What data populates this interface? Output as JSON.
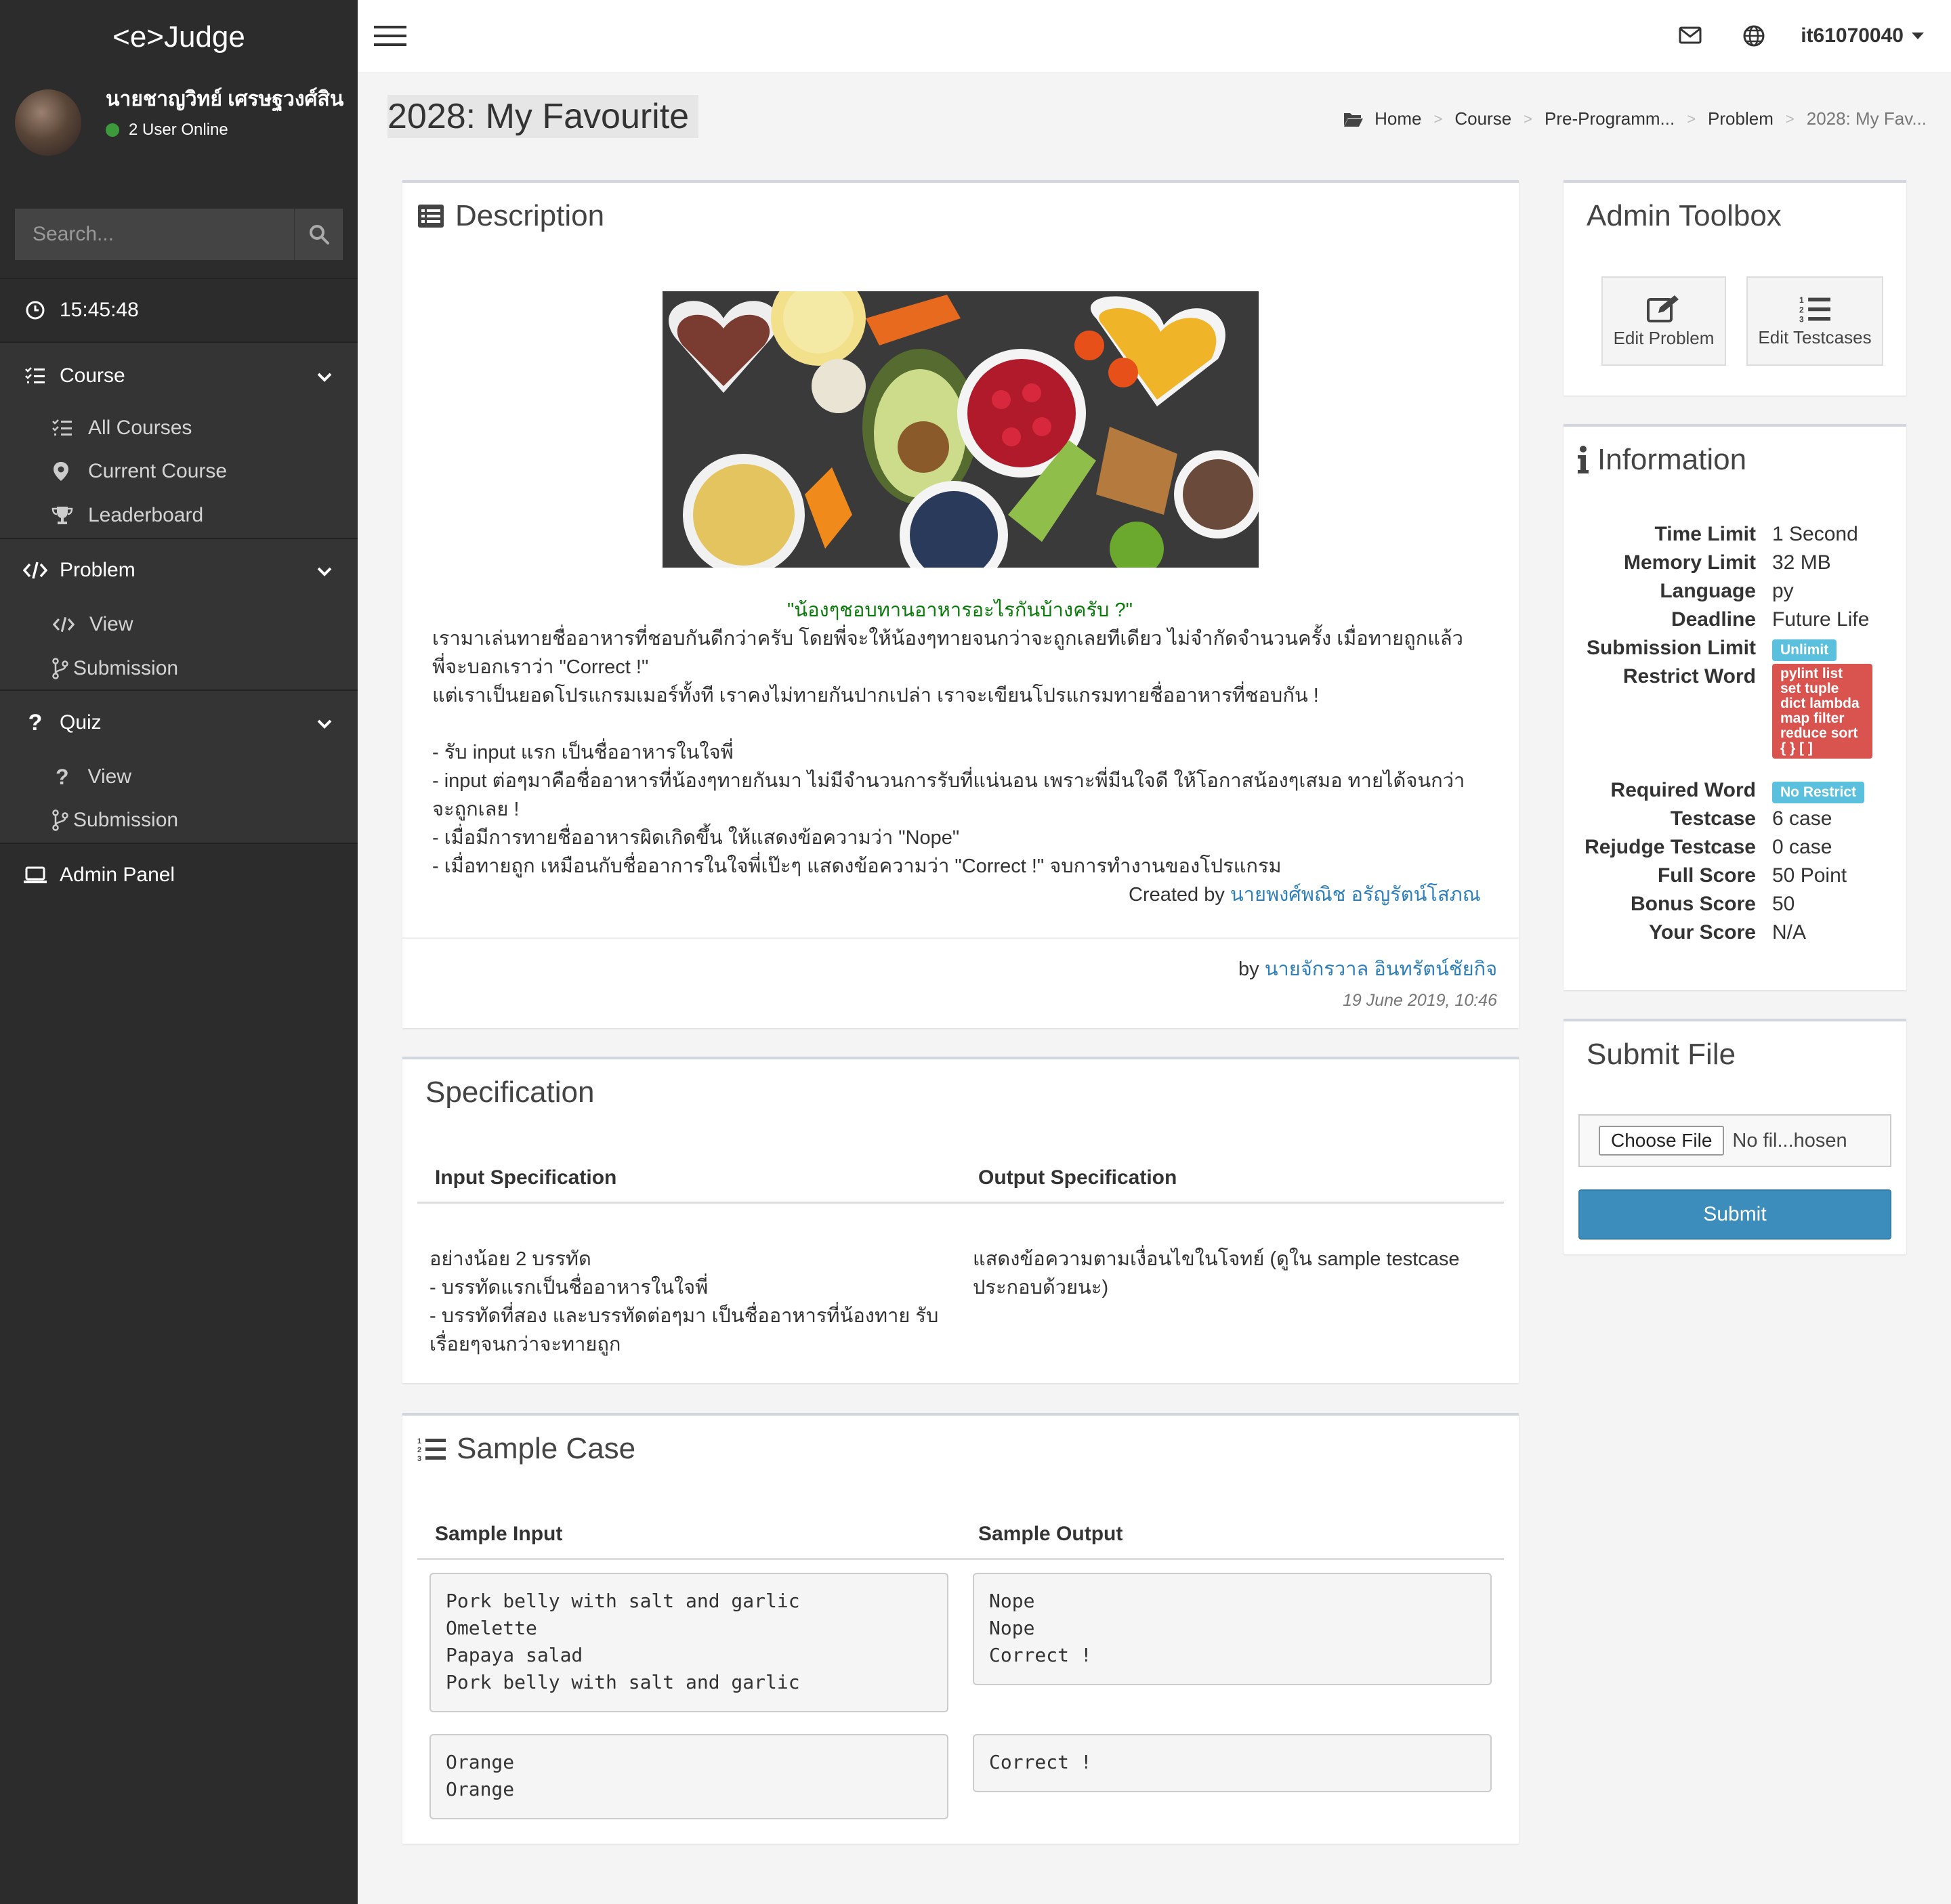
{
  "app": {
    "logo": "<e>Judge"
  },
  "user": {
    "name": "นายชาญวิทย์ เศรษฐวงศ์สิน",
    "online_text": "2 User Online",
    "username": "it61070040"
  },
  "search": {
    "placeholder": "Search..."
  },
  "clock": {
    "time": "15:45:48"
  },
  "sidebar": {
    "course": {
      "label": "Course",
      "items": [
        "All Courses",
        "Current Course",
        "Leaderboard"
      ]
    },
    "problem": {
      "label": "Problem",
      "items": [
        "View",
        "Submission"
      ]
    },
    "quiz": {
      "label": "Quiz",
      "items": [
        "View",
        "Submission"
      ]
    },
    "admin": {
      "label": "Admin Panel"
    }
  },
  "page": {
    "title": "2028: My Favourite"
  },
  "breadcrumb": [
    "Home",
    "Course",
    "Pre-Programm...",
    "Problem",
    "2028: My Fav..."
  ],
  "description": {
    "title": "Description",
    "headline": "\"น้องๆชอบทานอาหารอะไรกันบ้างครับ ?\"",
    "lines": [
      "    เรามาเล่นทายชื่ออาหารที่ชอบกันดีกว่าครับ โดยพี่จะให้น้องๆทายจนกว่าจะถูกเลยทีเดียว ไม่จำกัดจำนวนครั้ง เมื่อทายถูกแล้ว",
      "พี่จะบอกเราว่า \"Correct !\"",
      "แต่เราเป็นยอดโปรแกรมเมอร์ทั้งที เราคงไม่ทายกันปากเปล่า เราจะเขียนโปรแกรมทายชื่ออาหารที่ชอบกัน !",
      "",
      "- รับ input แรก เป็นชื่ออาหารในใจพี่",
      "- input ต่อๆมาคือชื่ออาหารที่น้องๆทายกันมา ไม่มีจำนวนการรับที่แน่นอน เพราะพี่มีนใจดี ให้โอกาสน้องๆเสมอ ทายได้จนกว่า",
      "จะถูกเลย !",
      "- เมื่อมีการทายชื่ออาหารผิดเกิดขึ้น ให้แสดงข้อความว่า \"Nope\"",
      "- เมื่อทายถูก เหมือนกับชื่ออาการในใจพี่เป๊ะๆ แสดงข้อความว่า \"Correct !\" จบการทำงานของโปรแกรม"
    ],
    "created_by_label": "Created by",
    "created_by_name": "นายพงศ์พณิช อรัญรัตน์โสภณ",
    "by_label": "by",
    "author": "นายจักรวาล อินทรัตน์ชัยกิจ",
    "date": "19 June 2019, 10:46"
  },
  "specification": {
    "title": "Specification",
    "input_header": "Input Specification",
    "output_header": "Output Specification",
    "input_lines": [
      "อย่างน้อย 2 บรรทัด",
      "- บรรทัดแรกเป็นชื่ออาหารในใจพี่",
      "- บรรทัดที่สอง และบรรทัดต่อๆมา เป็นชื่ออาหารที่น้องทาย รับ",
      "เรื่อยๆจนกว่าจะทายถูก"
    ],
    "output_lines": [
      "แสดงข้อความตามเงื่อนไขในโจทย์ (ดูใน sample testcase",
      "ประกอบด้วยนะ)"
    ]
  },
  "sample": {
    "title": "Sample Case",
    "input_header": "Sample Input",
    "output_header": "Sample Output",
    "cases": [
      {
        "input": "Pork belly with salt and garlic\nOmelette\nPapaya salad\nPork belly with salt and garlic",
        "output": "Nope\nNope\nCorrect !"
      },
      {
        "input": "Orange\nOrange",
        "output": "Correct !"
      }
    ]
  },
  "toolbox": {
    "title": "Admin Toolbox",
    "edit_problem": "Edit Problem",
    "edit_testcases": "Edit Testcases"
  },
  "information": {
    "title": "Information",
    "time_limit_k": "Time Limit",
    "time_limit_v": "1 Second",
    "memory_limit_k": "Memory Limit",
    "memory_limit_v": "32 MB",
    "language_k": "Language",
    "language_v": "py",
    "deadline_k": "Deadline",
    "deadline_v": "Future Life",
    "submission_limit_k": "Submission Limit",
    "submission_limit_v": "Unlimit",
    "restrict_word_k": "Restrict Word",
    "restrict_word_v": "pylint list set tuple dict lambda map filter reduce sort { } [ ]",
    "required_word_k": "Required Word",
    "required_word_v": "No Restrict",
    "testcase_k": "Testcase",
    "testcase_v": "6 case",
    "rejudge_k": "Rejudge Testcase",
    "rejudge_v": "0 case",
    "full_score_k": "Full Score",
    "full_score_v": "50 Point",
    "bonus_score_k": "Bonus Score",
    "bonus_score_v": "50",
    "your_score_k": "Your Score",
    "your_score_v": "N/A"
  },
  "submit_file": {
    "title": "Submit File",
    "choose_label": "Choose File",
    "no_file": "No fil...hosen",
    "submit_label": "Submit"
  }
}
